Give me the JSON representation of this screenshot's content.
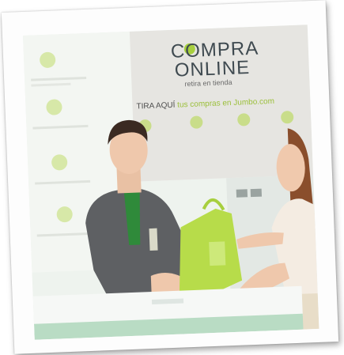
{
  "sign": {
    "brand_line1": "COMPRA",
    "brand_line2": "ONLINE",
    "brand_line3": "retira en tienda",
    "tagline_prefix": "TIRA AQUÍ",
    "tagline_accent": "tus compras en Jumbo.com"
  },
  "colors": {
    "brand_green": "#a7cf3e",
    "bag_green": "#b7dc4a",
    "wall": "#eef3ee",
    "sign_panel": "#e6e5e1",
    "counter_trim": "#b9dcc4",
    "shirt": "#5e6063"
  },
  "icons": [
    "leaf-icon",
    "pin-icon"
  ]
}
